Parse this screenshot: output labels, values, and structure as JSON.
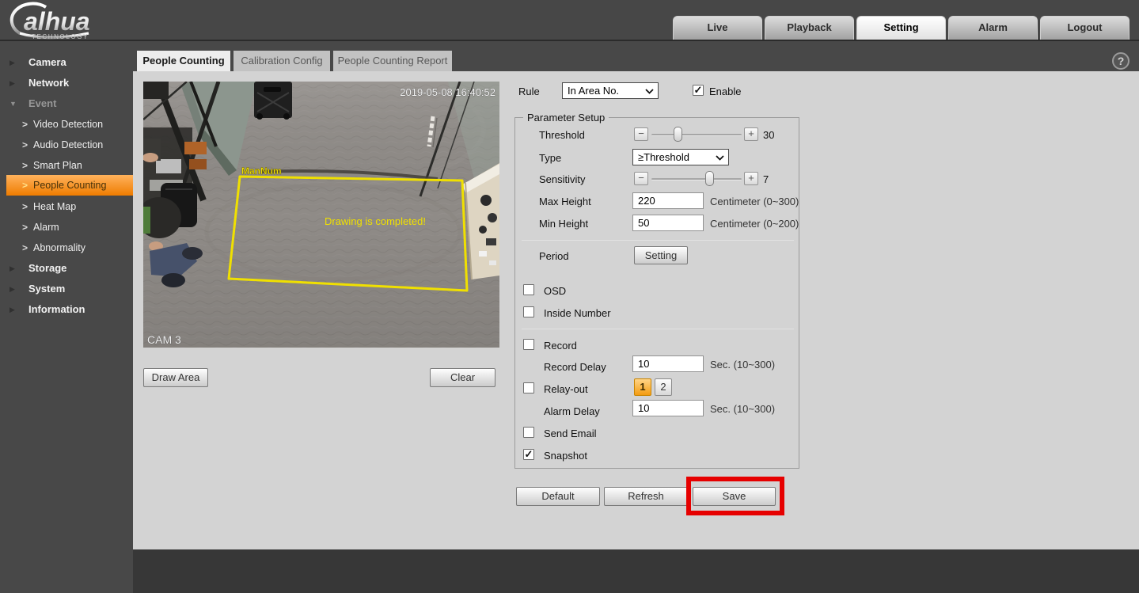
{
  "brand": {
    "logo_text": "alhua",
    "logo_subtext": "TECHNOLOGY"
  },
  "icons": {
    "check": "✓",
    "help": "?",
    "collapsed_arrow": "▶",
    "expanded_arrow": "▼",
    "submenu_arrow": ">",
    "minus": "−",
    "plus": "+"
  },
  "colors": {
    "accent_orange": "#ef7c00",
    "highlight_red": "#e60000",
    "overlay_yellow": "#f0e000",
    "content_bg": "#d3d3d3"
  },
  "top_nav": {
    "items": [
      {
        "label": "Live",
        "active": false
      },
      {
        "label": "Playback",
        "active": false
      },
      {
        "label": "Setting",
        "active": true
      },
      {
        "label": "Alarm",
        "active": false
      },
      {
        "label": "Logout",
        "active": false
      }
    ]
  },
  "sidebar": {
    "items": [
      {
        "label": "Camera",
        "level": "top",
        "state": "collapsed"
      },
      {
        "label": "Network",
        "level": "top",
        "state": "collapsed"
      },
      {
        "label": "Event",
        "level": "top",
        "state": "expanded"
      },
      {
        "label": "Video Detection",
        "level": "sub",
        "selected": false
      },
      {
        "label": "Audio Detection",
        "level": "sub",
        "selected": false
      },
      {
        "label": "Smart Plan",
        "level": "sub",
        "selected": false
      },
      {
        "label": "People Counting",
        "level": "sub",
        "selected": true
      },
      {
        "label": "Heat Map",
        "level": "sub",
        "selected": false
      },
      {
        "label": "Alarm",
        "level": "sub",
        "selected": false
      },
      {
        "label": "Abnormality",
        "level": "sub",
        "selected": false
      },
      {
        "label": "Storage",
        "level": "top",
        "state": "collapsed"
      },
      {
        "label": "System",
        "level": "top",
        "state": "collapsed"
      },
      {
        "label": "Information",
        "level": "top",
        "state": "collapsed"
      }
    ]
  },
  "content_tabs": [
    {
      "label": "People Counting",
      "active": true
    },
    {
      "label": "Calibration Config",
      "active": false
    },
    {
      "label": "People Counting Report",
      "active": false
    }
  ],
  "video": {
    "timestamp": "2019-05-08 16:40:52",
    "region_label": "ManNum",
    "status_message": "Drawing is completed!",
    "camera_label": "CAM 3"
  },
  "video_actions": {
    "draw_area": "Draw Area",
    "clear": "Clear"
  },
  "rule": {
    "label": "Rule",
    "selected_option": "In Area No.",
    "enable_label": "Enable",
    "enable_checked": true
  },
  "parameter_setup": {
    "legend": "Parameter Setup",
    "threshold": {
      "label": "Threshold",
      "value": "30"
    },
    "type": {
      "label": "Type",
      "selected_option": "≥Threshold"
    },
    "sensitivity": {
      "label": "Sensitivity",
      "value": "7"
    },
    "max_height": {
      "label": "Max Height",
      "value": "220",
      "unit": "Centimeter (0~300)"
    },
    "min_height": {
      "label": "Min Height",
      "value": "50",
      "unit": "Centimeter (0~200)"
    },
    "period": {
      "label": "Period",
      "button_label": "Setting"
    },
    "osd": {
      "label": "OSD",
      "checked": false
    },
    "inside_number": {
      "label": "Inside Number",
      "checked": false
    },
    "record": {
      "label": "Record",
      "checked": false
    },
    "record_delay": {
      "label": "Record Delay",
      "value": "10",
      "unit": "Sec. (10~300)"
    },
    "relay_out": {
      "label": "Relay-out",
      "checked": false,
      "channels": [
        "1",
        "2"
      ],
      "selected_channel": "1"
    },
    "alarm_delay": {
      "label": "Alarm Delay",
      "value": "10",
      "unit": "Sec. (10~300)"
    },
    "send_email": {
      "label": "Send Email",
      "checked": false
    },
    "snapshot": {
      "label": "Snapshot",
      "checked": true
    }
  },
  "actions": {
    "default": "Default",
    "refresh": "Refresh",
    "save": "Save"
  }
}
